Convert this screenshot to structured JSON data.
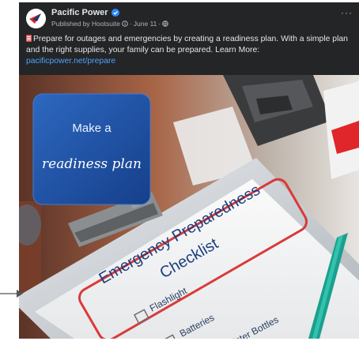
{
  "post": {
    "page_name": "Pacific Power",
    "published_by": "Published by Hootsuite",
    "date": "June 11",
    "more_label": "···",
    "caption_text": "Prepare for outages and emergencies by creating a readiness plan. With a simple plan and the right supplies, your family can be prepared. Learn More:",
    "link": "pacificpower.net/prepare"
  },
  "image": {
    "card_line1": "Make a",
    "card_line2": "readiness plan",
    "checklist_title_line1": "Emergency Preparedness",
    "checklist_title_line2": "Checklist",
    "items": [
      "Flashlight",
      "Batteries",
      "Water Bottles"
    ]
  },
  "colors": {
    "post_bg": "#242526",
    "link": "#4da3ff",
    "card_blue": "#1f56a8",
    "checklist_red": "#d93a3a",
    "brand_red": "#e0262a",
    "verified": "#2d88ff"
  }
}
